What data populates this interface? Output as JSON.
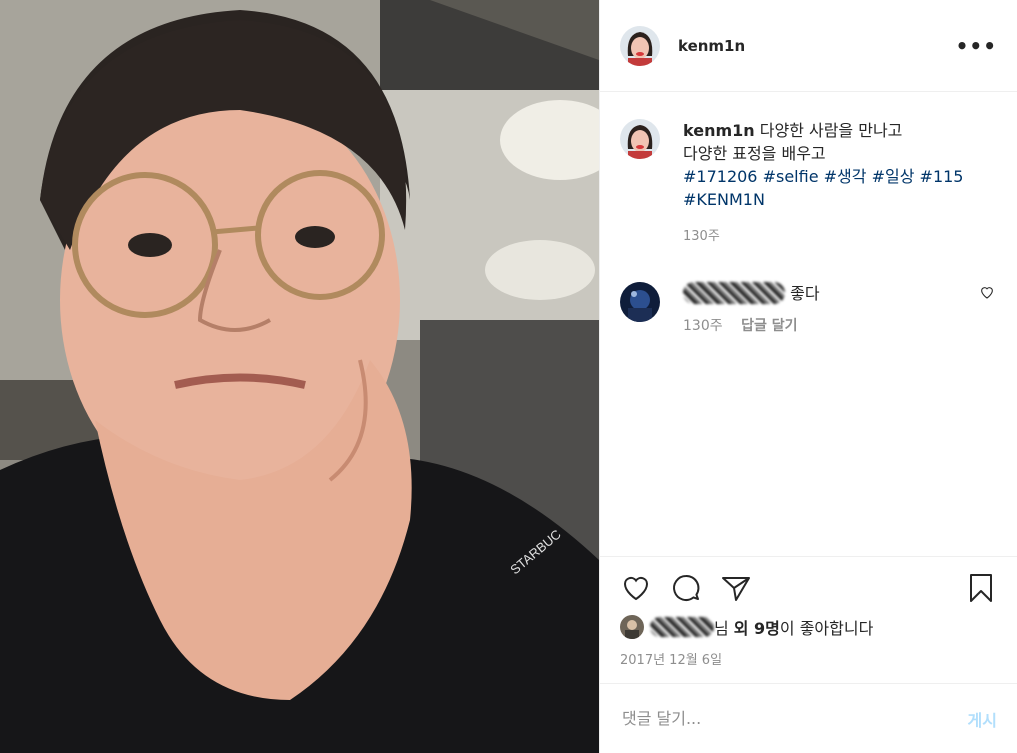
{
  "post": {
    "author": "kenm1n",
    "caption_lines": [
      "다양한 사람을 만나고",
      "다양한 표정을 배우고"
    ],
    "hashtags": [
      "#171206",
      "#selfie",
      "#생각",
      "#일상",
      "#115",
      "#KENM1N"
    ],
    "caption_age": "130주"
  },
  "comment": {
    "text": "좋다",
    "age": "130주",
    "reply_label": "답글 달기"
  },
  "likes": {
    "suffix_name": "님",
    "others": "외 9명",
    "tail": "이 좋아합니다"
  },
  "date": "2017년 12월 6일",
  "add_comment": {
    "placeholder": "댓글 달기...",
    "post_label": "게시"
  },
  "photo": {
    "shirt_text": "STARBUC"
  },
  "colors": {
    "hashtag": "#003569",
    "post_button": "#b2dffc",
    "meta": "#8e8e8e"
  }
}
